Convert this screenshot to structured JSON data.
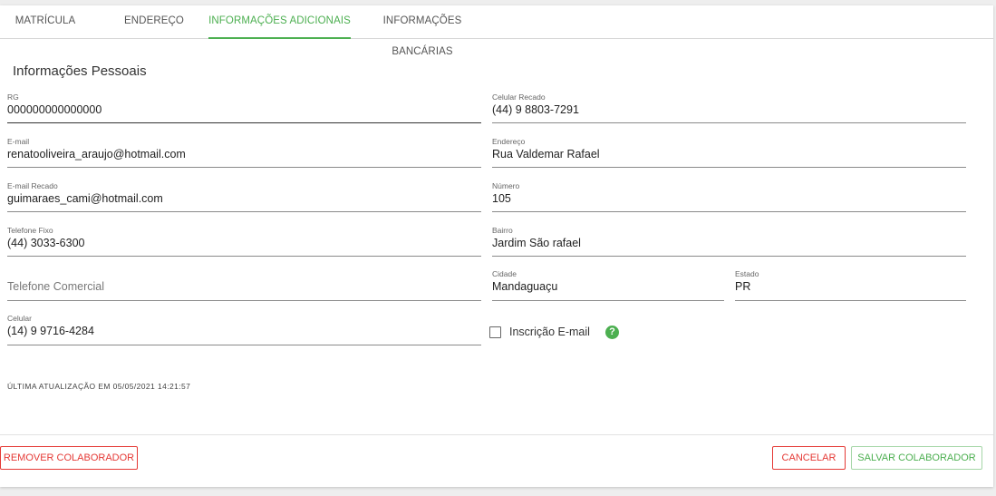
{
  "tabs": [
    {
      "label": "MATRÍCULA",
      "active": false
    },
    {
      "label": "ENDEREÇO",
      "active": false
    },
    {
      "label": "INFORMAÇÕES ADICIONAIS",
      "active": true
    },
    {
      "label": "INFORMAÇÕES BANCÁRIAS",
      "active": false
    }
  ],
  "section_title": "Informações Pessoais",
  "fields": {
    "rg": {
      "label": "RG",
      "value": "000000000000000"
    },
    "email": {
      "label": "E-mail",
      "value": "renatooliveira_araujo@hotmail.com"
    },
    "email_recado": {
      "label": "E-mail Recado",
      "value": "guimaraes_cami@hotmail.com"
    },
    "telefone_fixo": {
      "label": "Telefone Fixo",
      "value": "(44) 3033-6300"
    },
    "telefone_comercial": {
      "placeholder": "Telefone Comercial"
    },
    "celular": {
      "label": "Celular",
      "value": "(14) 9 9716-4284"
    },
    "celular_recado": {
      "label": "Celular Recado",
      "value": "(44) 9 8803-7291"
    },
    "endereco": {
      "label": "Endereço",
      "value": "Rua Valdemar Rafael"
    },
    "numero": {
      "label": "Número",
      "value": "105"
    },
    "bairro": {
      "label": "Bairro",
      "value": "Jardim São rafael"
    },
    "cidade": {
      "label": "Cidade",
      "value": "Mandaguaçu"
    },
    "estado": {
      "label": "Estado",
      "value": "PR"
    }
  },
  "inscricao_email": {
    "label": "Inscrição E-mail",
    "checked": false,
    "help_icon": "?"
  },
  "last_update": "ÚLTIMA ATUALIZAÇÃO EM 05/05/2021 14:21:57",
  "buttons": {
    "remove": "REMOVER COLABORADOR",
    "cancel": "CANCELAR",
    "save": "SALVAR COLABORADOR"
  },
  "colors": {
    "accent_green": "#4caf50",
    "danger_red": "#e53935"
  }
}
